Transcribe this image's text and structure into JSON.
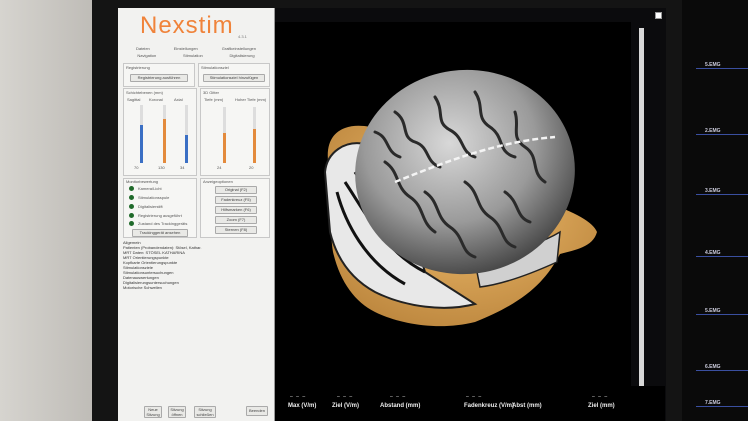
{
  "app": {
    "logo": "Nexstim",
    "version": "4.3.1"
  },
  "tabs": {
    "row1": [
      "Dateien",
      "Einstellungen",
      "Grafikeinstellungen"
    ],
    "row2": [
      "Navigation",
      "Stimulation",
      "Digitalisierung"
    ]
  },
  "registration": {
    "section": "Registrierung",
    "button": "Registrierung ausführen"
  },
  "stimulation": {
    "section": "Stimulationsziel",
    "button": "Stimulationsziel hinzufügen"
  },
  "slices": {
    "title": "Schichtebenen (mm)",
    "labels": [
      "Sagittal",
      "Koronal",
      "Axial"
    ],
    "values": [
      "70",
      "130",
      "34"
    ]
  },
  "grid3d": {
    "title": "3D Gitter",
    "labels": [
      "Tiefe (mm)",
      "Hoher Tiefe (mm)"
    ],
    "values": [
      "24",
      "20"
    ]
  },
  "monitoring": {
    "title": "Monitorbewertung",
    "items": [
      "Kamera/Licht",
      "Stimulationsspule",
      "Digitalisierstift",
      "Registrierung ausgeführt",
      "Zustand des Trackinggeräts",
      "Trackinggerät ansehen"
    ]
  },
  "view_options": {
    "title": "Anzeigeoptionen",
    "items": [
      "Original (F2)",
      "Fadenkreuz (F5)",
      "Hilfsmarken (F6)",
      "Zoom (F7)",
      "Sternen (F8)"
    ]
  },
  "tree": {
    "items": [
      "Allgemein",
      "Patienten (Probandendaten): Stösel, Kathar.",
      "MRT Daten: STÖSEL KATHARINA",
      "MRT Orientierungspunkte",
      "Kopfkarte Orientierungspunkte",
      "Stimulationsziele",
      "Stimulationsuntersuchungen",
      "Datenauswertungen",
      "Digitalisierungsuntersuchungen",
      "Motorische Schwellen"
    ]
  },
  "footer": {
    "buttons": [
      "Neue Sitzung",
      "Sitzung öffnen",
      "Sitzung schließen",
      "Beenden"
    ]
  },
  "bottom": {
    "labels": [
      "Max (V/m)",
      "Ziel (V/m)",
      "Abstand (mm)",
      "Fadenkreuz (V/m)",
      "Abst (mm)",
      "Ziel (mm)"
    ],
    "dash": "– – –"
  },
  "right_monitor": {
    "labels": [
      "5.EMG",
      "2.EMG",
      "3.EMG",
      "4.EMG",
      "5.EMG",
      "6.EMG",
      "7.EMG"
    ]
  }
}
